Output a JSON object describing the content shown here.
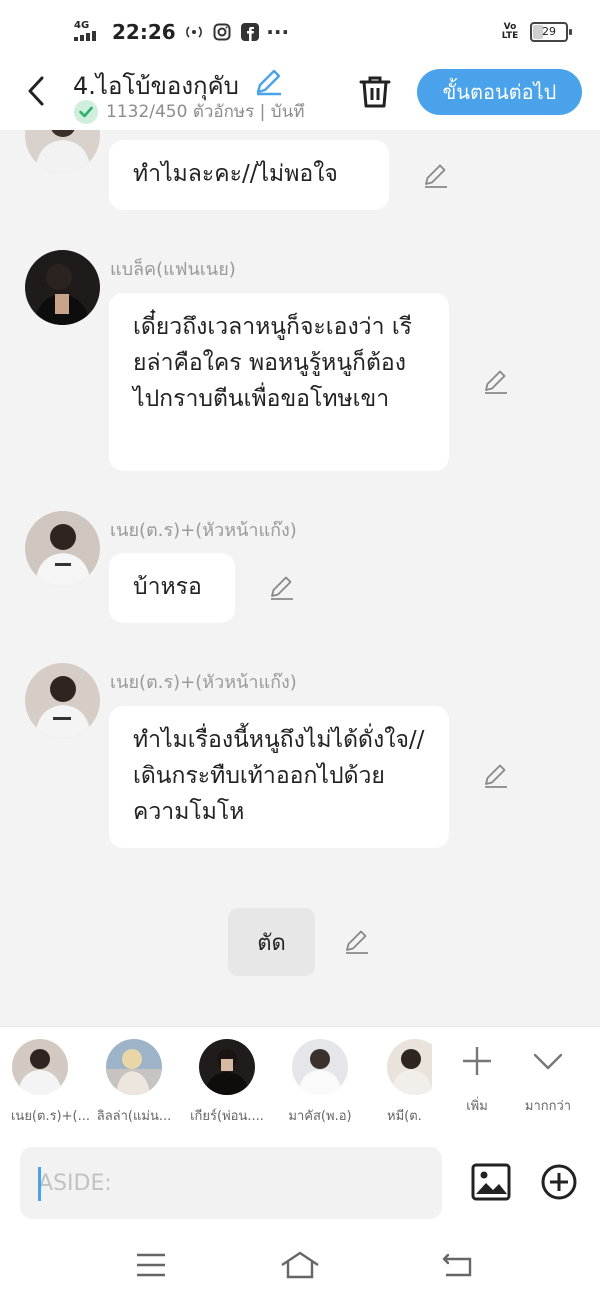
{
  "status_bar": {
    "network": "4G",
    "time": "22:26",
    "volte": "Vo LTE",
    "battery": "29",
    "battery_level": 0.29
  },
  "header": {
    "title": "4.ไอโบ้ของกุคับ",
    "char_count": "1132/450 ตัวอักษร | บันทึ",
    "next_label": "ขั้นตอนต่อไป"
  },
  "messages": [
    {
      "text": "ทำไมละคะ//ไม่พอใจ"
    },
    {
      "sender": "แบล็ค(แฟนเนย)",
      "text": "เดี๋ยวถึงเวลาหนูก็จะเองว่า เรียล่าคือใคร พอหนูรู้หนูก็ต้องไปกราบตีนเพื่อขอโทษเขา"
    },
    {
      "sender": "เนย(ต.ร)+(หัวหน้าแก๊ง)",
      "text": "บ้าหรอ"
    },
    {
      "sender": "เนย(ต.ร)+(หัวหน้าแก๊ง)",
      "text": "ทำไมเรื่องนี้หนูถึงไม่ได้ดั่งใจ//เดินกระทืบเท้าออกไปด้วยความโมโห"
    }
  ],
  "cut_label": "ตัด",
  "characters": [
    {
      "name": "เนย(ต.ร)+(..."
    },
    {
      "name": "ลิลล่า(แม่น..."
    },
    {
      "name": "เกียร์(พ่อน...."
    },
    {
      "name": "มาคัส(พ.อ)"
    },
    {
      "name": "หมี(ต."
    }
  ],
  "tools": {
    "add_label": "เพิ่ม",
    "more_label": "มากกว่า"
  },
  "input": {
    "placeholder": "ASIDE:"
  },
  "colors": {
    "accent": "#4aa3ea",
    "background": "#f3f3f3",
    "bubble": "#ffffff"
  }
}
